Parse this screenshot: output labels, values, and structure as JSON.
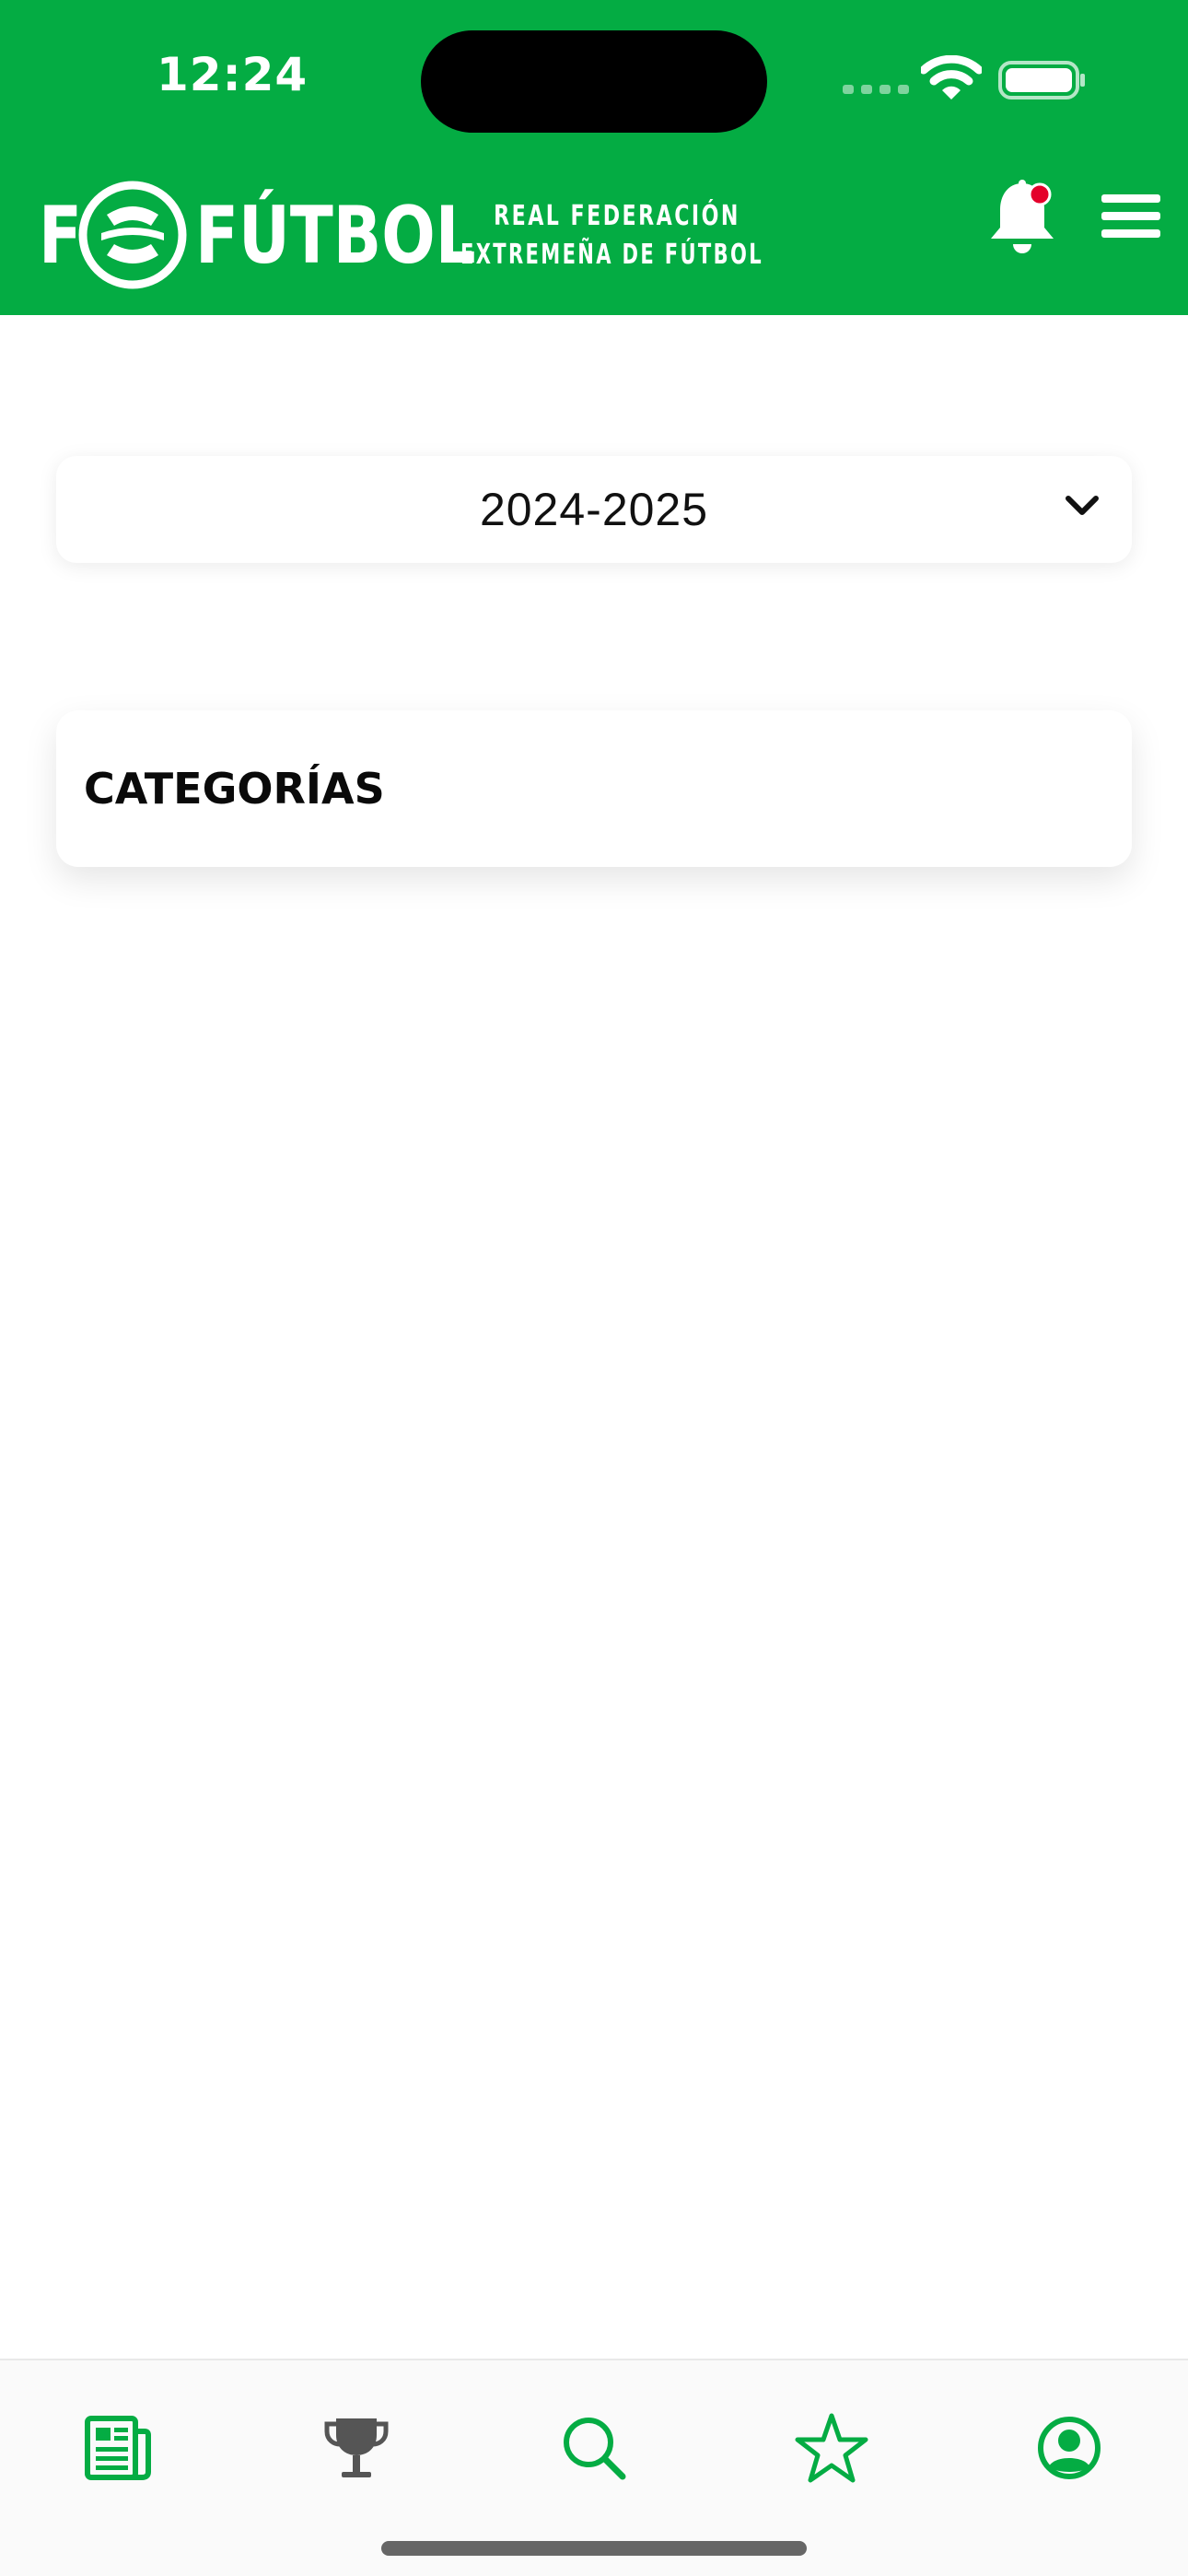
{
  "status_bar": {
    "time": "12:24"
  },
  "header": {
    "logo_letter": "F",
    "logo_word": "FÚTBOL",
    "tagline_line1": "REAL FEDERACIÓN",
    "tagline_line2": "EXTREMEÑA DE FÚTBOL",
    "notification_dot_color": "#e4002b",
    "brand_color": "#04ac43"
  },
  "season_selector": {
    "value": "2024-2025"
  },
  "categories": {
    "title": "CATEGORÍAS"
  },
  "tab_bar": {
    "items": [
      {
        "icon": "newspaper-icon",
        "color": "#04ac43"
      },
      {
        "icon": "trophy-icon",
        "color": "#555555"
      },
      {
        "icon": "search-icon",
        "color": "#04ac43"
      },
      {
        "icon": "star-icon",
        "color": "#04ac43"
      },
      {
        "icon": "profile-icon",
        "color": "#04ac43"
      }
    ]
  }
}
